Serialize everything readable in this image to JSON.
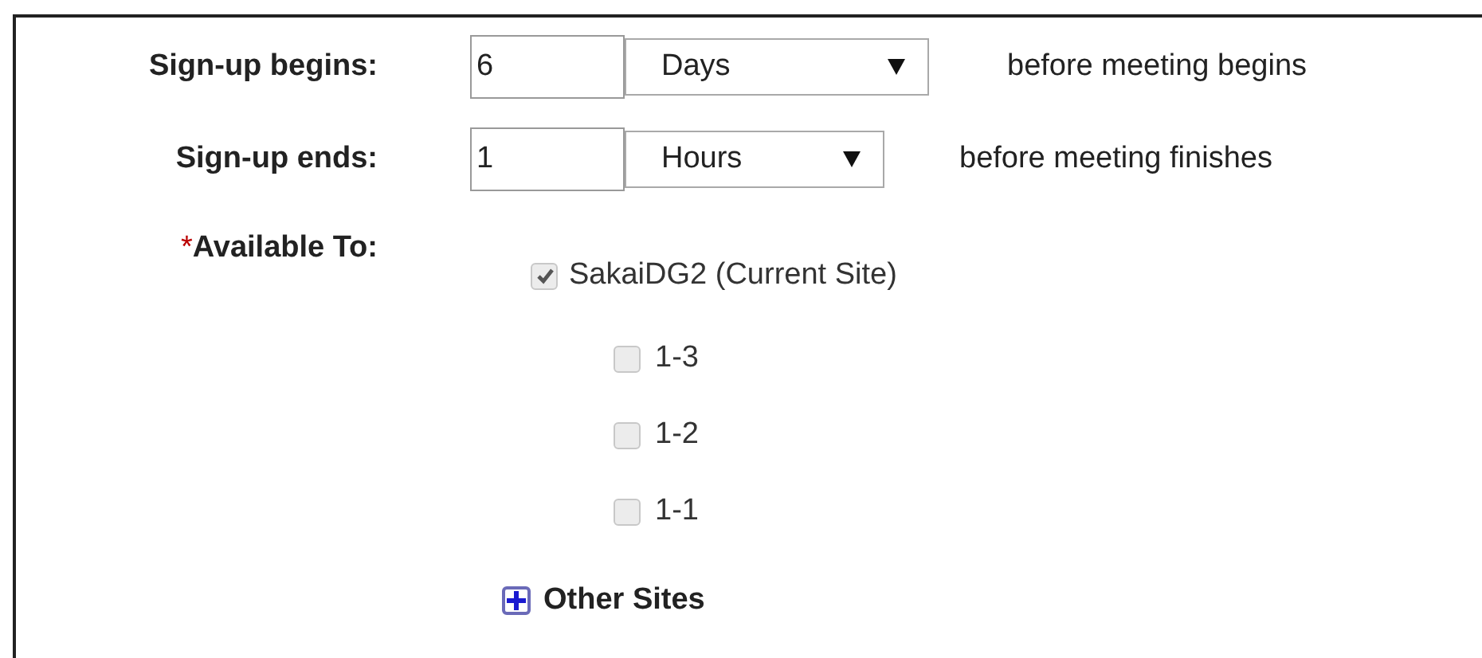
{
  "rows": [
    {
      "label": "Sign-up begins:",
      "value": "6",
      "unit": "Days",
      "suffix": "before meeting begins"
    },
    {
      "label": "Sign-up ends:",
      "value": "1",
      "unit": "Hours",
      "suffix": "before meeting finishes"
    }
  ],
  "available_to": {
    "label": "Available To:",
    "required_mark": "*",
    "site": {
      "label": "SakaiDG2 (Current Site)",
      "checked": true,
      "disabled": true
    },
    "groups": [
      {
        "label": "1-3",
        "checked": false,
        "disabled": true
      },
      {
        "label": "1-2",
        "checked": false,
        "disabled": true
      },
      {
        "label": "1-1",
        "checked": false,
        "disabled": true
      }
    ],
    "other_sites": {
      "label": "Other Sites",
      "expanded": false
    }
  }
}
